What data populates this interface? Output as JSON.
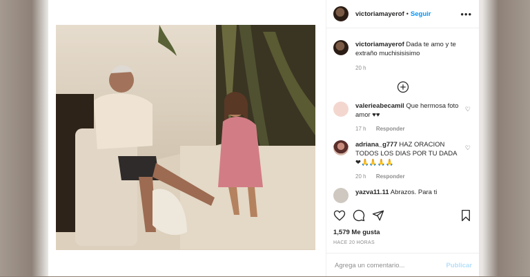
{
  "post": {
    "username": "victoriamayerof",
    "follow_label": "Seguir",
    "dot": "•",
    "more_label": "•••",
    "caption_text": "Dada te amo y te extraño muchisisisimo",
    "caption_time": "20 h",
    "likes": "1,579 Me gusta",
    "time_ago": "HACE 20 HORAS",
    "comment_placeholder": "Agrega un comentario...",
    "publish_label": "Publicar"
  },
  "comments": [
    {
      "user": "valerieabecamil",
      "text": "Que hermosa foto amor ♥♥",
      "time": "17 h",
      "reply": "Responder"
    },
    {
      "user": "adriana_g777",
      "text": "HAZ ORACION TODOS LOS DIAS POR TU DADA ❤🙏🙏🙏🙏",
      "time": "20 h",
      "reply": "Responder"
    },
    {
      "user": "yazva11.11",
      "text": "Abrazos. Para ti",
      "time": "",
      "reply": ""
    }
  ],
  "colors": {
    "link_blue": "#0095f6",
    "publish_disabled": "#b2dffc",
    "meta_gray": "#8e8e8e",
    "text": "#262626"
  },
  "icons": [
    "heart-icon",
    "comment-icon",
    "share-icon",
    "bookmark-icon",
    "plus-circle-icon",
    "more-icon"
  ]
}
